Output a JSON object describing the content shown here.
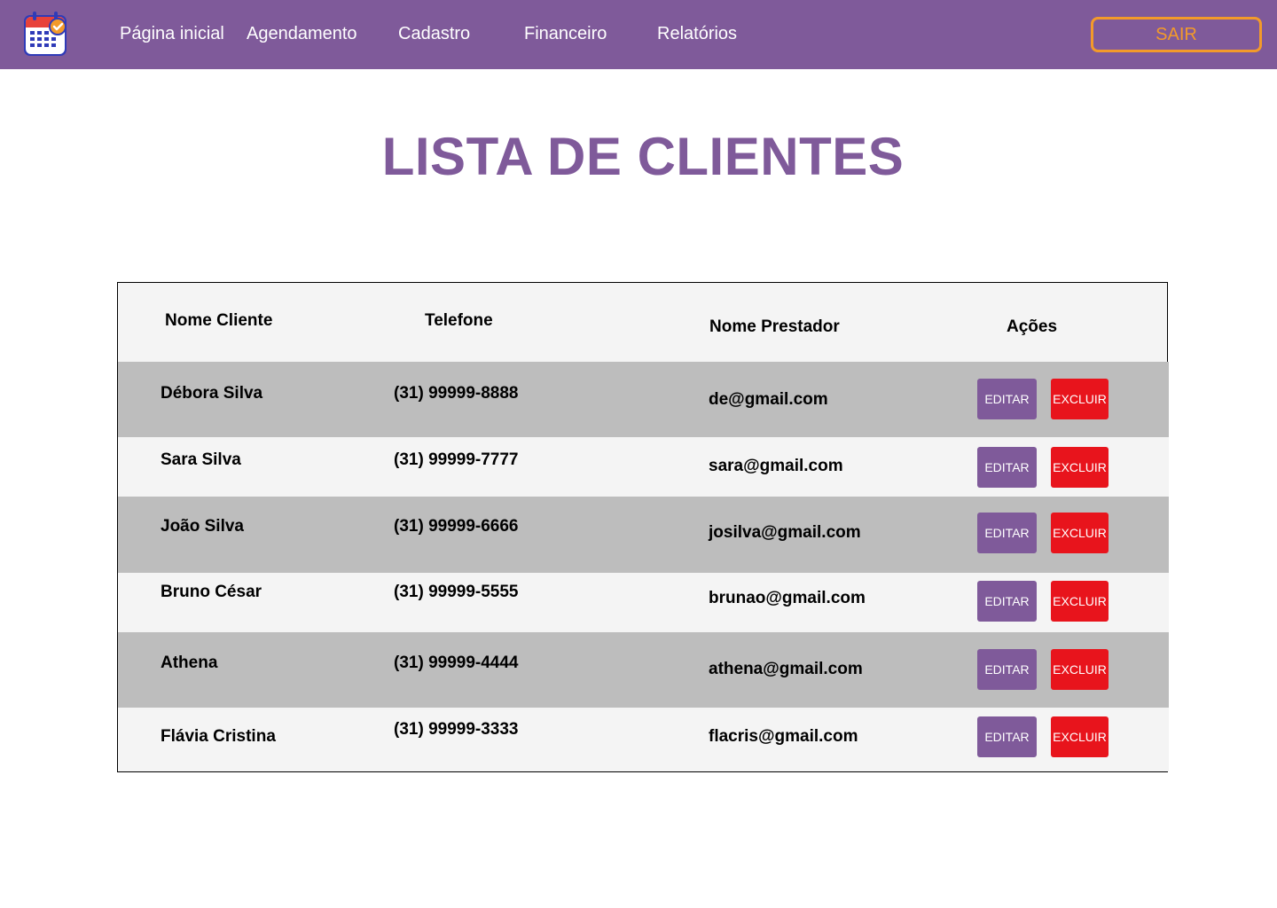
{
  "nav": {
    "logo_icon": "calendar-check-icon",
    "links": [
      "Página inicial",
      "Agendamento",
      "Cadastro",
      "Financeiro",
      "Relatórios"
    ],
    "logout_label": "SAIR"
  },
  "page": {
    "title": "LISTA DE CLIENTES"
  },
  "table": {
    "columns": [
      "Nome Cliente",
      "Telefone",
      "Nome Prestador",
      "Ações"
    ],
    "rows": [
      {
        "name": "Débora Silva",
        "phone": "(31) 99999-8888",
        "provider": "de@gmail.com",
        "edit": "EDITAR",
        "delete": "EXCLUIR"
      },
      {
        "name": "Sara Silva",
        "phone": "(31) 99999-7777",
        "provider": "sara@gmail.com",
        "edit": "EDITAR",
        "delete": "EXCLUIR"
      },
      {
        "name": "João Silva",
        "phone": "(31) 99999-6666",
        "provider": "josilva@gmail.com",
        "edit": "EDITAR",
        "delete": "EXCLUIR"
      },
      {
        "name": "Bruno César",
        "phone": "(31) 99999-5555",
        "provider": "brunao@gmail.com",
        "edit": "EDITAR",
        "delete": "EXCLUIR"
      },
      {
        "name": "Athena",
        "phone": "(31) 99999-4444",
        "provider": "athena@gmail.com",
        "edit": "EDITAR",
        "delete": "EXCLUIR"
      },
      {
        "name": "Flávia Cristina",
        "phone": "(31) 99999-3333",
        "provider": "flacris@gmail.com",
        "edit": "EDITAR",
        "delete": "EXCLUIR"
      }
    ]
  },
  "colors": {
    "brand_purple": "#7F5A9A",
    "logout_orange": "#F39A2A",
    "delete_red": "#E8141C",
    "row_gray": "#BDBDBD",
    "row_light": "#F4F4F4"
  }
}
